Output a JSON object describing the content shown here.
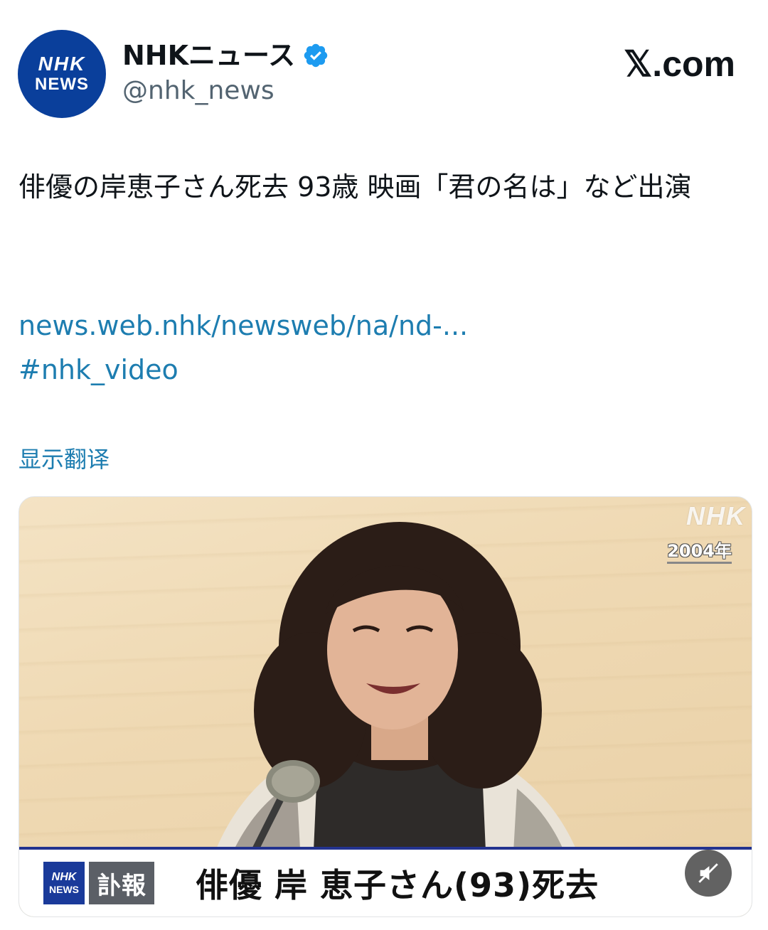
{
  "account": {
    "avatar_line1": "NHK",
    "avatar_line2": "NEWS",
    "display_name": "NHKニュース",
    "handle": "@nhk_news",
    "verified": true
  },
  "site": {
    "label": "𝕏.com"
  },
  "tweet": {
    "text": "俳優の岸恵子さん死去 93歳 映画「君の名は」など出演",
    "link": "news.web.nhk/newsweb/na/nd-...",
    "hashtag": "#nhk_video",
    "translate_label": "显示翻译"
  },
  "media": {
    "watermark": "NHK",
    "year_label": "2004年",
    "caption_logo_line1": "NHK",
    "caption_logo_line2": "NEWS",
    "caption_tag": "訃報",
    "caption_headline": "俳優 岸 恵子さん(93)死去",
    "mute_icon": "speaker-muted-icon"
  },
  "colors": {
    "nhk_blue": "#0a3f9b",
    "link_blue": "#1d7db0",
    "verified_blue": "#1d9bf0"
  }
}
